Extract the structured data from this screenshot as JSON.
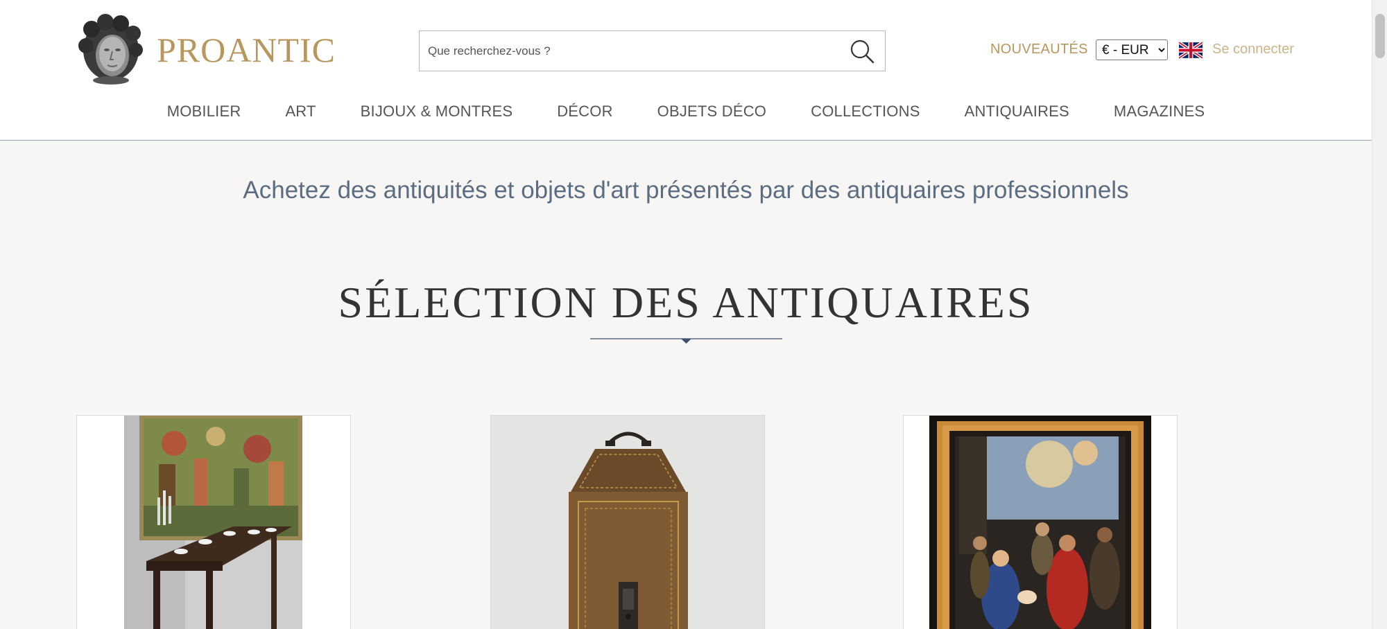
{
  "header": {
    "logo_text": "PROANTIC",
    "search": {
      "placeholder": "Que recherchez-vous ?",
      "value": ""
    },
    "nouveautes_label": "NOUVEAUTÉS",
    "currency": {
      "selected": "€ - EUR",
      "options": [
        "€ - EUR"
      ]
    },
    "language_flag": "uk-flag-icon",
    "login_label": "Se connecter"
  },
  "nav": {
    "items": [
      "MOBILIER",
      "ART",
      "BIJOUX & MONTRES",
      "DÉCOR",
      "OBJETS DÉCO",
      "COLLECTIONS",
      "ANTIQUAIRES",
      "MAGAZINES"
    ]
  },
  "main": {
    "tagline": "Achetez des antiquités et objets d'art présentés par des antiquaires professionnels",
    "section_title": "SÉLECTION DES ANTIQUAIRES",
    "cards": [
      {
        "icon": "tapestry-dining-table-image"
      },
      {
        "icon": "leather-knife-box-image"
      },
      {
        "icon": "framed-nativity-painting-image"
      }
    ]
  },
  "colors": {
    "gold": "#b8975e",
    "gold_light": "#cbb48a",
    "nav_text": "#555555",
    "tagline_blue": "#5a6d82",
    "background": "#f7f6f4",
    "divider": "#5a6d82"
  }
}
